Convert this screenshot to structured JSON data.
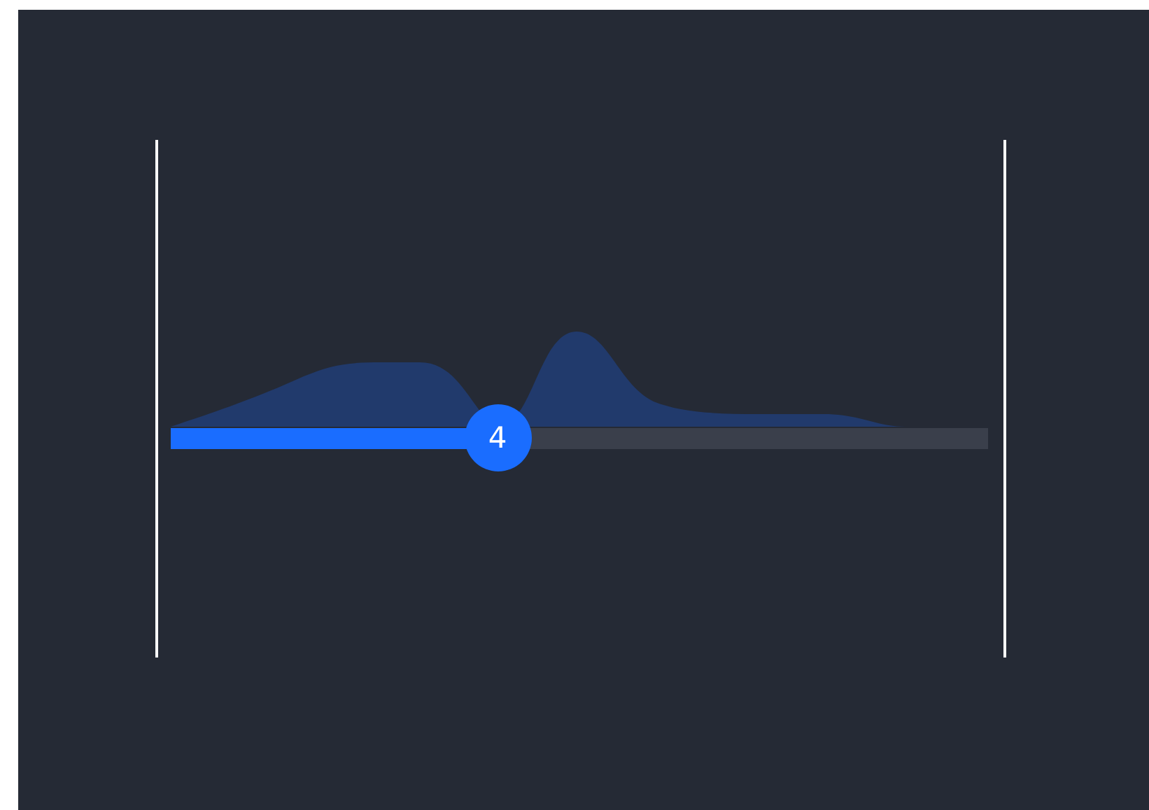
{
  "slider": {
    "value": "4",
    "level": 0.4
  }
}
